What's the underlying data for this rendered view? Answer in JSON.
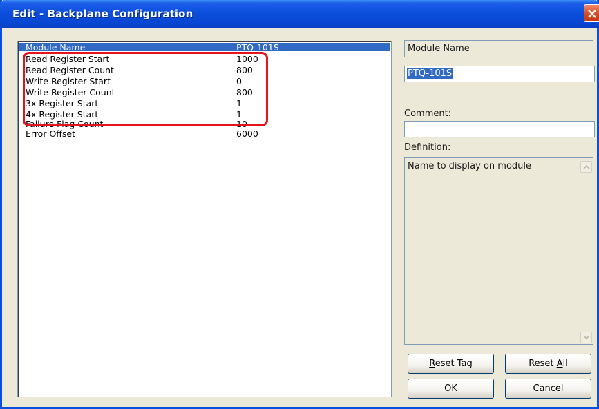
{
  "window": {
    "title": "Edit - Backplane Configuration"
  },
  "list": {
    "items": [
      {
        "name": "Module Name",
        "value": "PTQ-101S",
        "selected": true
      },
      {
        "name": "Read Register Start",
        "value": "1000"
      },
      {
        "name": "Read Register Count",
        "value": "800"
      },
      {
        "name": "Write Register Start",
        "value": "0"
      },
      {
        "name": "Write Register Count",
        "value": "800"
      },
      {
        "name": "3x Register Start",
        "value": "1"
      },
      {
        "name": "4x Register Start",
        "value": "1"
      },
      {
        "name": "Failure Flag Count",
        "value": "10"
      },
      {
        "name": "Error Offset",
        "value": "6000"
      }
    ]
  },
  "details": {
    "field_name": "Module Name",
    "field_value": "PTQ-101S",
    "comment_label": "Comment:",
    "comment_value": "",
    "definition_label": "Definition:",
    "definition_text": "Name to display on module"
  },
  "buttons": {
    "reset_tag": {
      "accel": "R",
      "rest": "eset Tag"
    },
    "reset_all": {
      "prefix": "Reset ",
      "accel": "A",
      "rest": "ll"
    },
    "ok": "OK",
    "cancel": "Cancel"
  },
  "colors": {
    "titlebar": "#0a4ddb",
    "selection": "#316ac5",
    "highlight_annotation": "#e3141b",
    "dialog_background": "#ece9d8"
  },
  "icons": {
    "close": "close-x-icon",
    "scroll_up": "triangle-up-icon",
    "scroll_down": "triangle-down-icon"
  }
}
